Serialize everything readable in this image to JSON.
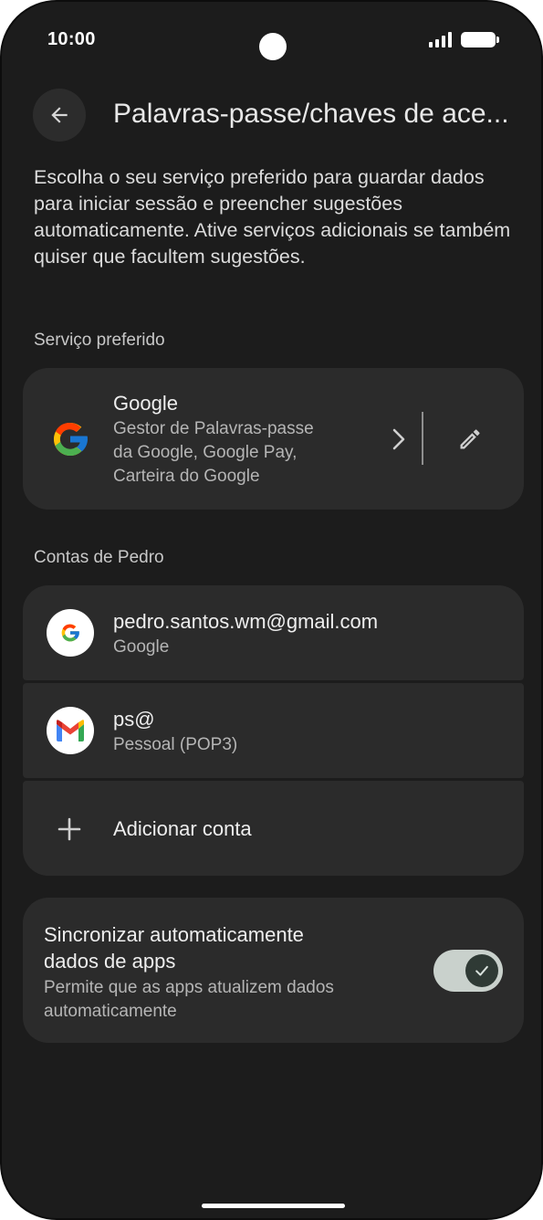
{
  "status_bar": {
    "time": "10:00"
  },
  "header": {
    "title": "Palavras-passe/chaves de ace..."
  },
  "intro": "Escolha o seu serviço preferido para guardar dados para iniciar sessão e preencher sugestões automaticamente. Ative serviços adicionais se também quiser que facultem sugestões.",
  "preferred": {
    "section_label": "Serviço preferido",
    "service": {
      "name": "Google",
      "description_lines": [
        "Gestor de Palavras-passe",
        "da Google, Google Pay,",
        "Carteira do Google"
      ]
    }
  },
  "accounts": {
    "section_label": "Contas de Pedro",
    "items": [
      {
        "title": "pedro.santos.wm@gmail.com",
        "subtitle": "Google",
        "icon": "google-g-icon"
      },
      {
        "title": "ps@",
        "subtitle": "Pessoal (POP3)",
        "icon": "gmail-icon"
      }
    ],
    "add_label": "Adicionar conta"
  },
  "sync": {
    "title_lines": [
      "Sincronizar automaticamente",
      "dados de apps"
    ],
    "subtitle_lines": [
      "Permite que as apps atualizem dados",
      "automaticamente"
    ],
    "enabled": true
  },
  "colors": {
    "background": "#1c1c1c",
    "card": "#2b2b2b",
    "toggle_track": "#c9d1cc",
    "google_blue": "#4285F4",
    "google_red": "#EA4335",
    "google_yellow": "#FBBC05",
    "google_green": "#34A853"
  }
}
